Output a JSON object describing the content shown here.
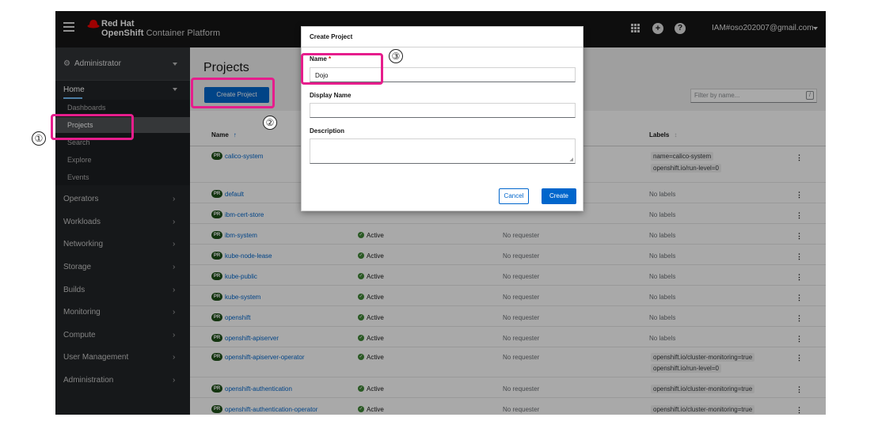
{
  "masthead": {
    "brand_top": "Red Hat",
    "brand_bold": "OpenShift",
    "brand_rest": " Container Platform",
    "user": "IAM#oso202007@gmail.com",
    "icons": [
      "menu-icon",
      "app-launcher-icon",
      "import-plus-icon",
      "help-icon",
      "caret-down-icon"
    ]
  },
  "sidebar": {
    "perspective": "Administrator",
    "home": "Home",
    "home_items": [
      "Dashboards",
      "Projects",
      "Search",
      "Explore",
      "Events"
    ],
    "active_item": "Projects",
    "sections": [
      "Operators",
      "Workloads",
      "Networking",
      "Storage",
      "Builds",
      "Monitoring",
      "Compute",
      "User Management",
      "Administration"
    ]
  },
  "page": {
    "title": "Projects",
    "create_button": "Create Project",
    "filter_placeholder": "Filter by name...",
    "filter_key": "/"
  },
  "table": {
    "columns": {
      "name": "Name",
      "labels": "Labels"
    },
    "badge": "PR",
    "rows": [
      {
        "name": "calico-system",
        "status": "",
        "requester": "",
        "labels": [
          "name=calico-system",
          "openshift.io/run-level=0"
        ]
      },
      {
        "name": "default",
        "status": "",
        "requester": "",
        "labels_text": "No labels"
      },
      {
        "name": "ibm-cert-store",
        "status": "",
        "requester": "",
        "labels_text": "No labels"
      },
      {
        "name": "ibm-system",
        "status": "Active",
        "requester": "No requester",
        "labels_text": "No labels"
      },
      {
        "name": "kube-node-lease",
        "status": "Active",
        "requester": "No requester",
        "labels_text": "No labels"
      },
      {
        "name": "kube-public",
        "status": "Active",
        "requester": "No requester",
        "labels_text": "No labels"
      },
      {
        "name": "kube-system",
        "status": "Active",
        "requester": "No requester",
        "labels_text": "No labels"
      },
      {
        "name": "openshift",
        "status": "Active",
        "requester": "No requester",
        "labels_text": "No labels"
      },
      {
        "name": "openshift-apiserver",
        "status": "Active",
        "requester": "No requester",
        "labels_text": "No labels"
      },
      {
        "name": "openshift-apiserver-operator",
        "status": "Active",
        "requester": "No requester",
        "labels": [
          "openshift.io/cluster-monitoring=true",
          "openshift.io/run-level=0"
        ]
      },
      {
        "name": "openshift-authentication",
        "status": "Active",
        "requester": "No requester",
        "labels": [
          "openshift.io/cluster-monitoring=true"
        ]
      },
      {
        "name": "openshift-authentication-operator",
        "status": "Active",
        "requester": "No requester",
        "labels": [
          "openshift.io/cluster-monitoring=true"
        ]
      }
    ]
  },
  "modal": {
    "title": "Create Project",
    "name_label": "Name",
    "required_mark": "*",
    "name_value": "Dojo",
    "display_name_label": "Display Name",
    "display_name_value": "",
    "description_label": "Description",
    "description_value": "",
    "cancel": "Cancel",
    "create": "Create"
  },
  "annotations": {
    "step1": "①",
    "step2": "②",
    "step3": "③",
    "color": "#e61d8c"
  }
}
